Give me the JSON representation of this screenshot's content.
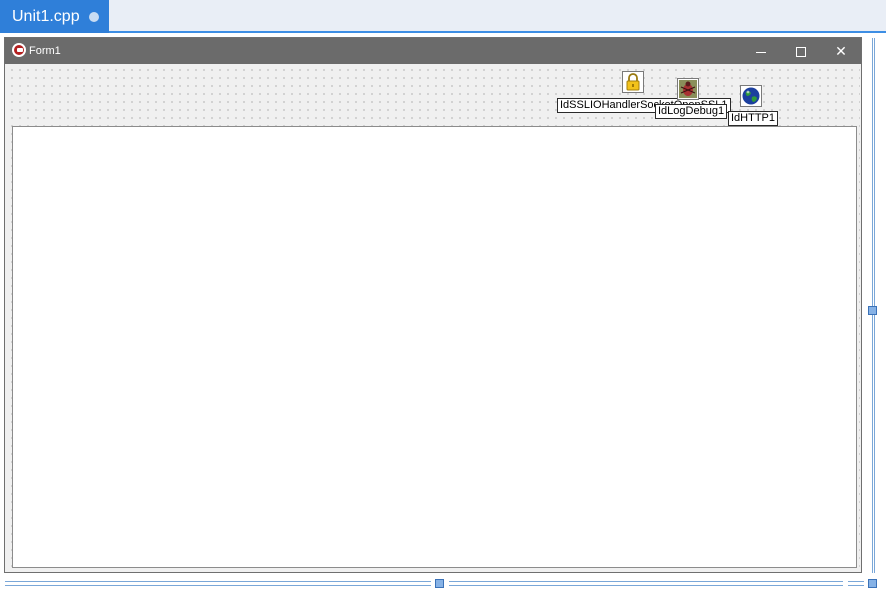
{
  "editor": {
    "tab_label": "Unit1.cpp"
  },
  "form": {
    "title": "Form1",
    "minimize_icon": "minimize-icon",
    "maximize_icon": "maximize-icon",
    "close_icon": "close-icon",
    "close_glyph": "✕"
  },
  "components": [
    {
      "label": "IdSSLIOHandlerSocketOpenSSL1",
      "icon": "padlock-icon"
    },
    {
      "label": "IdLogDebug1",
      "icon": "bug-icon"
    },
    {
      "label": "IdHTTP1",
      "icon": "globe-icon"
    }
  ]
}
